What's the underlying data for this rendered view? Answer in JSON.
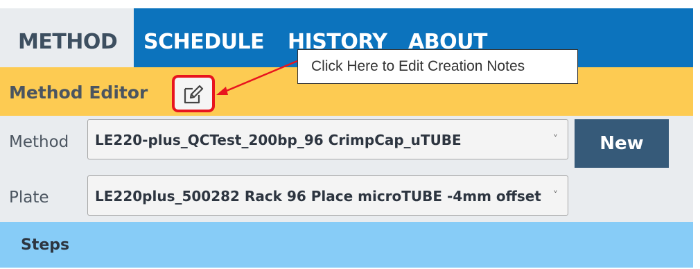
{
  "nav": {
    "tabs": [
      "METHOD",
      "SCHEDULE",
      "HISTORY",
      "ABOUT"
    ],
    "active_tab": "METHOD"
  },
  "editor": {
    "title": "Method Editor",
    "edit_icon": "edit-notes-icon"
  },
  "callout": {
    "text": "Click Here to Edit Creation Notes"
  },
  "form": {
    "method_label": "Method",
    "method_value": "LE220-plus_QCTest_200bp_96 CrimpCap_uTUBE",
    "plate_label": "Plate",
    "plate_value": "LE220plus_500282 Rack 96 Place microTUBE -4mm offset",
    "chevron": "˅"
  },
  "buttons": {
    "new_label": "New"
  },
  "steps": {
    "title": "Steps"
  },
  "colors": {
    "nav_blue": "#0c73bd",
    "active_tab_bg": "#e9ecef",
    "editor_bar": "#fdcb52",
    "highlight_red": "#e8141e",
    "new_button": "#365a79",
    "steps_bar": "#87ccf7"
  }
}
